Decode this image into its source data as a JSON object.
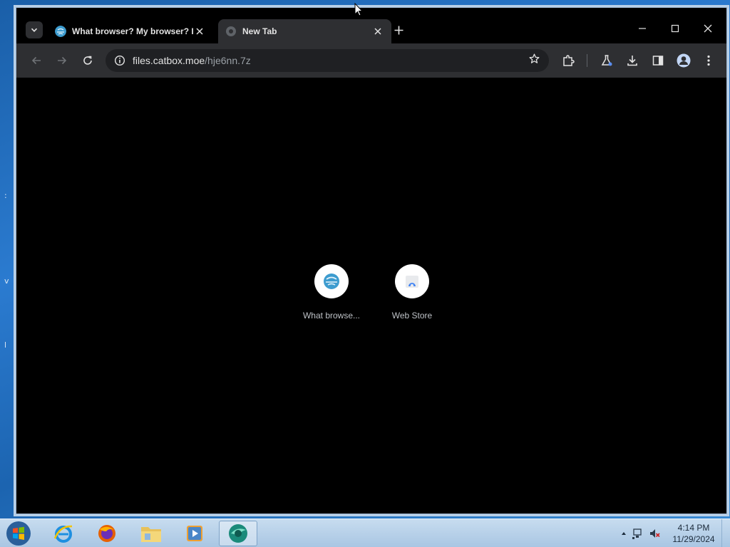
{
  "browser": {
    "tabs": [
      {
        "title": "What browser? My browser? Is",
        "favicon": "globe-icon",
        "active": false
      },
      {
        "title": "New Tab",
        "favicon": "chrome-newtab-icon",
        "active": true
      }
    ],
    "address_bar": {
      "domain": "files.catbox.moe",
      "path": "/hje6nn.7z"
    },
    "shortcuts": [
      {
        "label": "What browse...",
        "icon": "site-globe-icon"
      },
      {
        "label": "Web Store",
        "icon": "web-store-icon"
      }
    ]
  },
  "taskbar": {
    "apps": [
      "internet-explorer-icon",
      "firefox-icon",
      "file-explorer-icon",
      "media-player-icon",
      "browser-app-icon"
    ],
    "clock": {
      "time": "4:14 PM",
      "date": "11/29/2024"
    }
  },
  "colors": {
    "accent": "#2e2f32",
    "content_bg": "#000000",
    "taskbar": "#b8d0e8"
  }
}
